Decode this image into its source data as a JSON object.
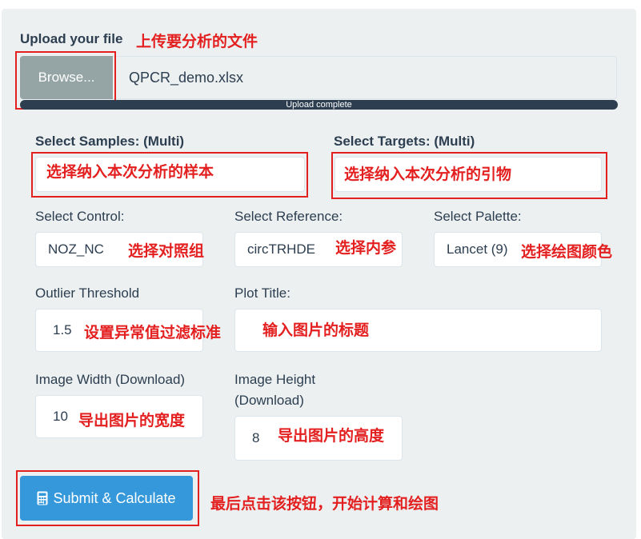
{
  "upload": {
    "label": "Upload your file",
    "annotation": "上传要分析的文件",
    "browse_label": "Browse...",
    "filename": "QPCR_demo.xlsx",
    "progress_text": "Upload complete",
    "progress_fraction": 1.0
  },
  "samples": {
    "label": "Select Samples: (Multi)",
    "annotation": "选择纳入本次分析的样本"
  },
  "targets": {
    "label": "Select Targets: (Multi)",
    "annotation": "选择纳入本次分析的引物"
  },
  "control": {
    "label": "Select Control:",
    "value": "NOZ_NC",
    "annotation": "选择对照组"
  },
  "reference": {
    "label": "Select Reference:",
    "value": "circTRHDE",
    "annotation": "选择内参"
  },
  "palette": {
    "label": "Select Palette:",
    "value": "Lancet (9)",
    "annotation": "选择绘图颜色"
  },
  "outlier": {
    "label": "Outlier Threshold",
    "value": "1.5",
    "annotation": "设置异常值过滤标准"
  },
  "plot_title": {
    "label": "Plot Title:",
    "value": "",
    "annotation": "输入图片的标题"
  },
  "image_width": {
    "label": "Image Width (Download)",
    "value": "10",
    "annotation": "导出图片的宽度"
  },
  "image_height": {
    "label_line1": "Image Height",
    "label_line2": "(Download)",
    "value": "8",
    "annotation": "导出图片的高度"
  },
  "submit": {
    "label": "Submit & Calculate",
    "icon": "calculator-icon",
    "annotation": "最后点击该按钮，开始计算和绘图"
  },
  "colors": {
    "panel": "#ecf0f1",
    "annotation_red": "#e31f1f",
    "primary": "#3498db",
    "browse": "#95a5a6",
    "text": "#2c3e50"
  }
}
